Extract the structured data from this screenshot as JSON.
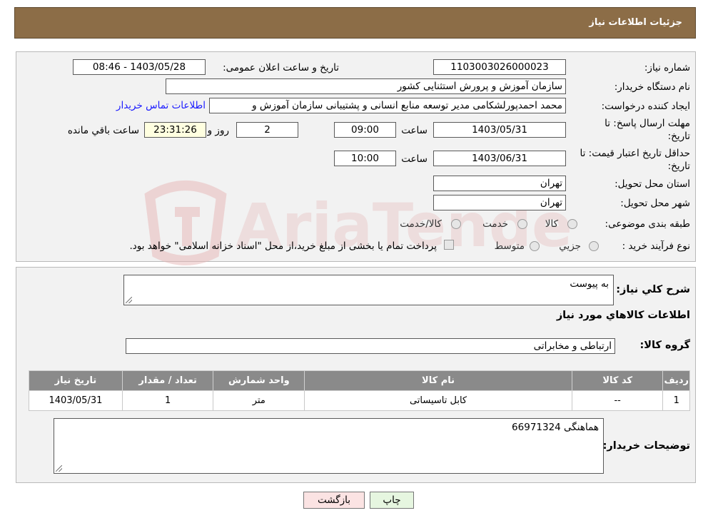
{
  "header": {
    "title": "جزئیات اطلاعات نیاز"
  },
  "info": {
    "need_number_label": "شماره نیاز:",
    "need_number": "1103003026000023",
    "announce_label": "تاریخ و ساعت اعلان عمومی:",
    "announce_value": "1403/05/28 - 08:46",
    "buyer_org_label": "نام دستگاه خریدار:",
    "buyer_org": "سازمان آموزش و پرورش استثنایی کشور",
    "requester_label": "ایجاد کننده درخواست:",
    "requester": "محمد احمدپورلشکامی مدیر توسعه منابع انسانی و پشتیبانی سازمان آموزش و",
    "contact_link": "اطلاعات تماس خریدار",
    "deadline_label_1": "مهلت ارسال پاسخ: تا",
    "deadline_label_2": "تاریخ:",
    "deadline_date": "1403/05/31",
    "time_label": "ساعت",
    "deadline_time": "09:00",
    "days_value": "2",
    "days_label": "روز و",
    "remaining_time": "23:31:26",
    "remaining_label": "ساعت باقي مانده",
    "validity_label_1": "حداقل تاریخ اعتبار قیمت: تا",
    "validity_label_2": "تاریخ:",
    "validity_date": "1403/06/31",
    "validity_time": "10:00",
    "province_label": "استان محل تحویل:",
    "province": "تهران",
    "city_label": "شهر محل تحویل:",
    "city": "تهران",
    "category_label": "طبقه بندی موضوعی:",
    "category_options": [
      "کالا",
      "خدمت",
      "کالا/خدمت"
    ],
    "purchase_type_label": "نوع فرآیند خرید :",
    "purchase_options": [
      "جزیي",
      "متوسط"
    ],
    "purchase_note": "پرداخت تمام یا بخشی از مبلغ خرید،از محل \"اسناد خزانه اسلامی\" خواهد بود."
  },
  "watermark": {
    "text": "AriaTender.neT"
  },
  "details": {
    "description_label": "شرح کلي نياز:",
    "description": "به پیوست",
    "items_title": "اطلاعات کالاهاي مورد نياز",
    "group_label": "گروه کالا:",
    "group_value": "ارتباطی و مخابراتی",
    "table": {
      "headers": [
        "رديف",
        "کد کالا",
        "نام کالا",
        "واحد شمارش",
        "تعداد / مقدار",
        "تاریخ نیاز"
      ],
      "rows": [
        [
          "1",
          "--",
          "کابل تاسیساتی",
          "متر",
          "1",
          "1403/05/31"
        ]
      ]
    },
    "buyer_notes_label": "توضيحات خريدار:",
    "buyer_notes": "هماهنگی 66971324"
  },
  "buttons": {
    "print": "چاپ",
    "back": "بازگشت"
  },
  "colors": {
    "header": "#8c6d47",
    "table_header": "#8a8a8a",
    "back_button": "#fbe3e3",
    "print_button": "#e6f6e0"
  }
}
